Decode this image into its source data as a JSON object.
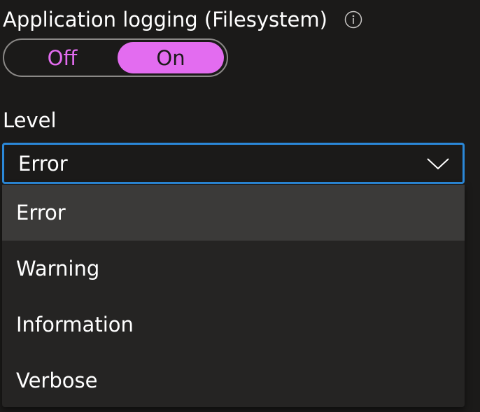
{
  "logging": {
    "title": "Application logging (Filesystem)",
    "info_icon": "info-icon",
    "toggle": {
      "off_label": "Off",
      "on_label": "On",
      "selected": "On"
    }
  },
  "level": {
    "label": "Level",
    "selected_value": "Error",
    "chevron_icon": "chevron-down-icon",
    "options": [
      {
        "label": "Error",
        "selected": true
      },
      {
        "label": "Warning",
        "selected": false
      },
      {
        "label": "Information",
        "selected": false
      },
      {
        "label": "Verbose",
        "selected": false
      }
    ]
  },
  "colors": {
    "accent": "#e36cf0",
    "focus_border": "#2b88d8",
    "background": "#1b1a19",
    "menu_background": "#252423",
    "menu_selected": "#3b3a39"
  }
}
